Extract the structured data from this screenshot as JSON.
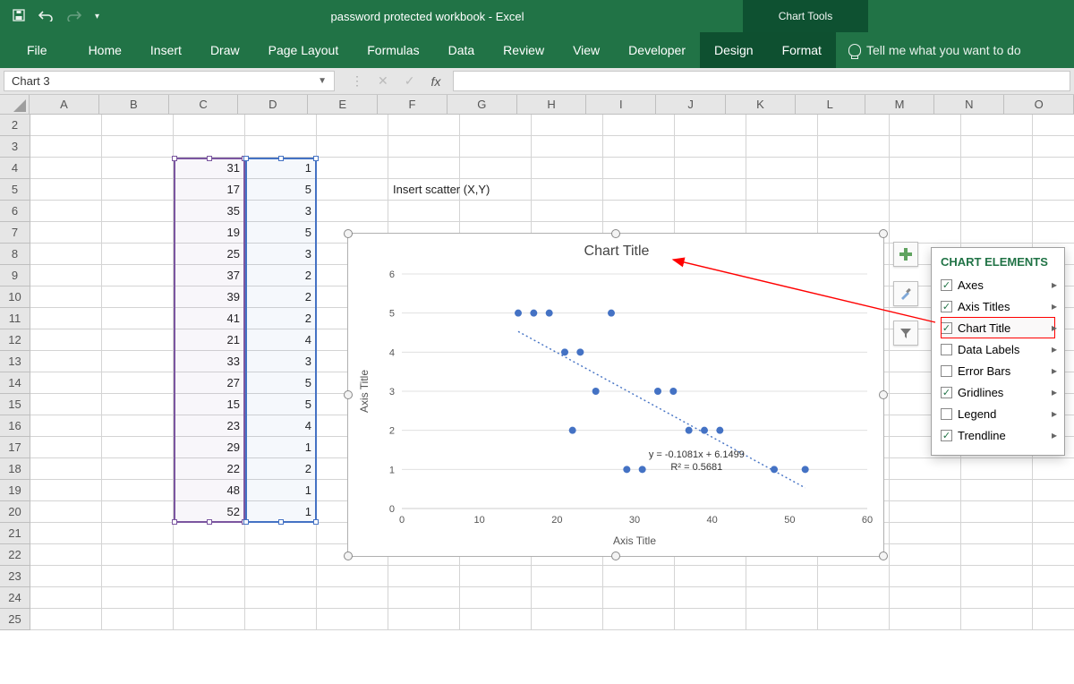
{
  "title": "password protected workbook  -  Excel",
  "chart_tools_label": "Chart Tools",
  "tabs": [
    "File",
    "Home",
    "Insert",
    "Draw",
    "Page Layout",
    "Formulas",
    "Data",
    "Review",
    "View",
    "Developer"
  ],
  "context_tabs": [
    "Design",
    "Format"
  ],
  "tellme": "Tell me what you want to do",
  "namebox": "Chart 3",
  "fx_label": "fx",
  "columns": [
    "A",
    "B",
    "C",
    "D",
    "E",
    "F",
    "G",
    "H",
    "I",
    "J",
    "K",
    "L",
    "M",
    "N",
    "O"
  ],
  "row_start": 2,
  "row_end": 25,
  "cell_F5": "Insert scatter (X,Y)",
  "data_C": [
    31,
    17,
    35,
    19,
    25,
    37,
    39,
    41,
    21,
    33,
    27,
    15,
    23,
    29,
    22,
    48,
    52
  ],
  "data_D": [
    1,
    5,
    3,
    5,
    3,
    2,
    2,
    2,
    4,
    3,
    5,
    5,
    4,
    1,
    2,
    1,
    1
  ],
  "chart_title": "Chart Title",
  "y_axis_title": "Axis Title",
  "x_axis_title": "Axis Title",
  "trend_eq": "y = -0.1081x + 6.1499",
  "trend_r2": "R² = 0.5681",
  "chart_elements_title": "CHART ELEMENTS",
  "chart_elements": [
    {
      "label": "Axes",
      "checked": true
    },
    {
      "label": "Axis Titles",
      "checked": true
    },
    {
      "label": "Chart Title",
      "checked": true,
      "highlight": true
    },
    {
      "label": "Data Labels",
      "checked": false
    },
    {
      "label": "Error Bars",
      "checked": false
    },
    {
      "label": "Gridlines",
      "checked": true
    },
    {
      "label": "Legend",
      "checked": false
    },
    {
      "label": "Trendline",
      "checked": true
    }
  ],
  "chart_data": {
    "type": "scatter",
    "title": "Chart Title",
    "xlabel": "Axis Title",
    "ylabel": "Axis Title",
    "xlim": [
      0,
      60
    ],
    "ylim": [
      0,
      6
    ],
    "x_ticks": [
      0,
      10,
      20,
      30,
      40,
      50,
      60
    ],
    "y_ticks": [
      0,
      1,
      2,
      3,
      4,
      5,
      6
    ],
    "x": [
      31,
      17,
      35,
      19,
      25,
      37,
      39,
      41,
      21,
      33,
      27,
      15,
      23,
      29,
      22,
      48,
      52
    ],
    "y": [
      1,
      5,
      3,
      5,
      3,
      2,
      2,
      2,
      4,
      3,
      5,
      5,
      4,
      1,
      2,
      1,
      1
    ],
    "trendline": {
      "slope": -0.1081,
      "intercept": 6.1499,
      "r2": 0.5681
    }
  }
}
